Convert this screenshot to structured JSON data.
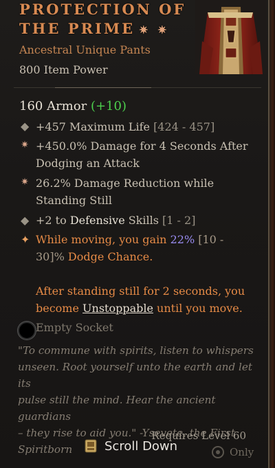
{
  "tooltip": {
    "title_line1": "PROTECTION OF",
    "title_line2": "THE PRIME",
    "title_stars": "✷ ✷",
    "item_type": "Ancestral Unique Pants",
    "item_power": "800 Item Power",
    "armor_text": "160 Armor",
    "armor_bonus": "(+10)",
    "affixes": [
      {
        "text": "+457 Maximum Life",
        "range": "[424 - 457]"
      },
      {
        "line1": "+450.0% Damage for 4 Seconds After",
        "line2": "Dodging an Attack"
      },
      {
        "line1": "26.2% Damage Reduction while",
        "line2": "Standing Still"
      },
      {
        "prefix": "+2 to ",
        "keyword": "Defensive",
        "middle": " Skills ",
        "range": "[1 - 2]"
      }
    ],
    "unique_effect": {
      "part1": "While moving, you gain ",
      "value": "22%",
      "range1": " [10 -",
      "range2": "30]%",
      "part2": " Dodge Chance.",
      "para2_line1": "After standing still for 2 seconds, you",
      "para2_pre": "become ",
      "para2_link": "Unstoppable",
      "para2_post": " until you move."
    },
    "socket_label": "Empty Socket",
    "flavor_lines": [
      "\"To commune with spirits, listen to whispers",
      "unseen. Root yourself unto the earth and let its",
      "pulse still the mind. Hear the ancient guardians",
      "– they rise to aid you.\" -Ysevete, the First",
      "Spiritborn"
    ],
    "requires": "Requires Level 60",
    "scroll_label": "Scroll Down",
    "only_label": "Only"
  },
  "colors": {
    "title": "#d88a52",
    "unique_orange": "#e58a46",
    "bonus_green": "#4dd04d",
    "value_purple": "#9a8cf0"
  },
  "icons": [
    "item-pants-image",
    "star-bullet-icon",
    "diamond-bullet-icon",
    "unique-star-icon",
    "socket-icon",
    "scroll-key-icon",
    "seal-icon"
  ]
}
